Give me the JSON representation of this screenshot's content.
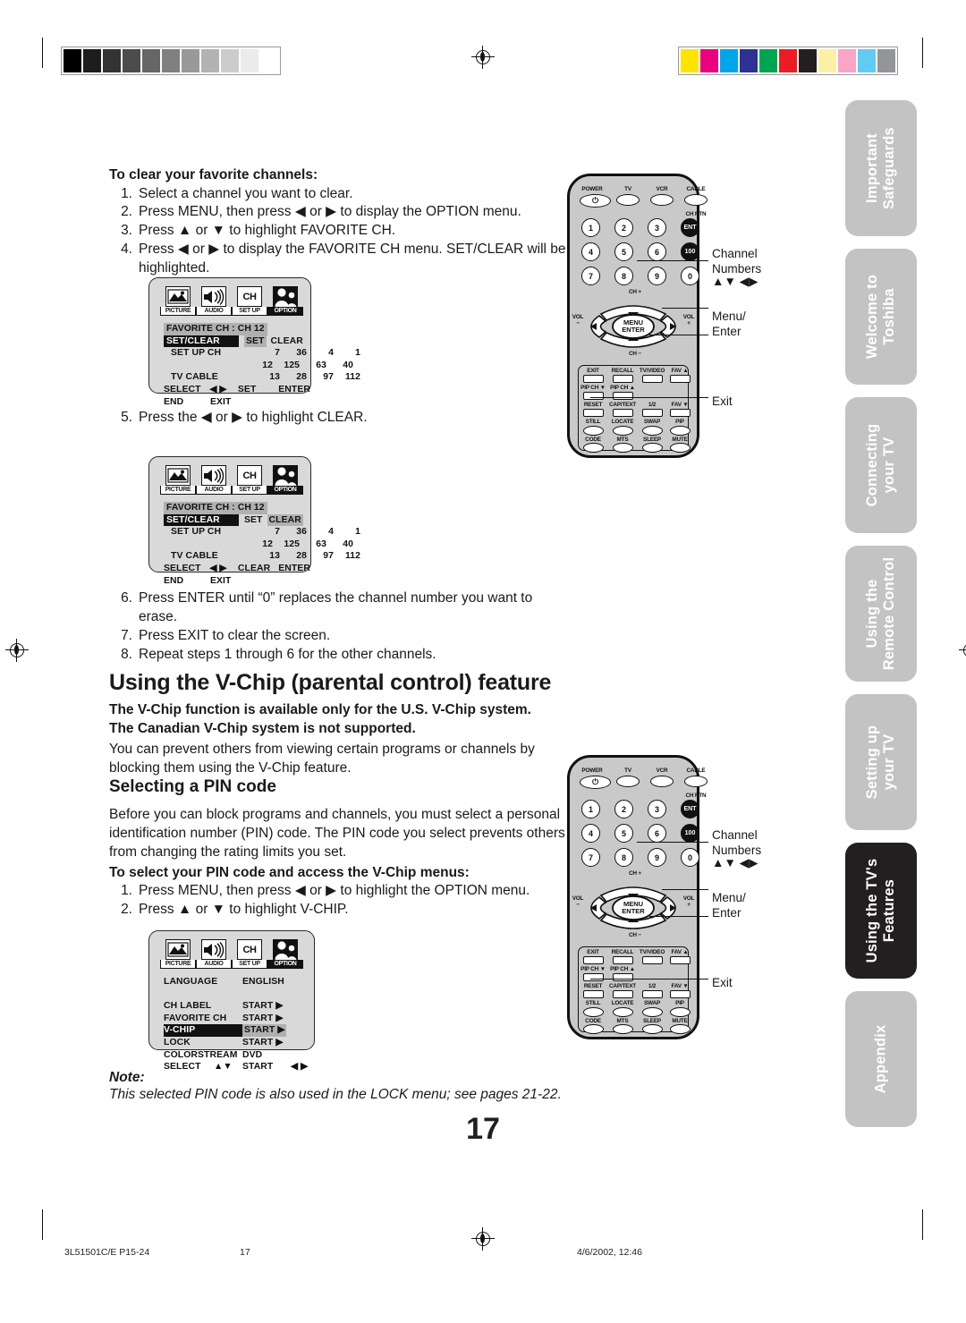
{
  "document": {
    "page_number": "17",
    "footer_left": "3L51501C/E P15-24",
    "footer_center": "17",
    "footer_right": "4/6/2002, 12:46"
  },
  "calibration": {
    "grayscale": [
      "#000000",
      "#1d1d1d",
      "#333333",
      "#4c4c4c",
      "#666666",
      "#808080",
      "#999999",
      "#b3b3b3",
      "#cccccc",
      "#ebebeb",
      "#ffffff"
    ],
    "colors": [
      "#ffe400",
      "#ea0080",
      "#00a6e9",
      "#2e3192",
      "#00a551",
      "#ed1c24",
      "#231f20",
      "#fbf0a5",
      "#f8a5c6",
      "#61cbf3",
      "#939598"
    ]
  },
  "sidebar": {
    "tabs": [
      {
        "label": "Important\nSafeguards",
        "active": false
      },
      {
        "label": "Welcome to\nToshiba",
        "active": false
      },
      {
        "label": "Connecting\nyour TV",
        "active": false
      },
      {
        "label": "Using the\nRemote Control",
        "active": false
      },
      {
        "label": "Setting up\nyour TV",
        "active": false
      },
      {
        "label": "Using the TV's\nFeatures",
        "active": true
      },
      {
        "label": "Appendix",
        "active": false
      }
    ]
  },
  "clear_favorites": {
    "heading": "To clear your favorite channels:",
    "steps": [
      {
        "num": "1.",
        "text": "Select a channel you want to clear."
      },
      {
        "num": "2.",
        "text": "Press MENU, then press ◀ or ▶ to display the OPTION menu."
      },
      {
        "num": "3.",
        "text": "Press ▲ or ▼ to highlight FAVORITE CH."
      },
      {
        "num": "4.",
        "text": "Press ◀ or ▶ to display the FAVORITE CH menu. SET/CLEAR will be highlighted."
      }
    ],
    "step5": {
      "num": "5.",
      "text": "Press the ◀ or ▶ to highlight CLEAR."
    },
    "steps_after": [
      {
        "num": "6.",
        "text": "Press ENTER until “0” replaces the channel number you want to erase."
      },
      {
        "num": "7.",
        "text": "Press EXIT to clear the screen."
      },
      {
        "num": "8.",
        "text": "Repeat steps 1 through 6 for the other channels."
      }
    ]
  },
  "vchip": {
    "section_title": "Using the V-Chip (parental control) feature",
    "bold_notice_line1": "The V-Chip function is available only for the U.S. V-Chip system.",
    "bold_notice_line2": "The Canadian V-Chip system is not supported.",
    "intro": "You can prevent others from viewing certain programs or channels by blocking them using the V-Chip feature.",
    "subsection_title": "Selecting a PIN code",
    "pin_intro": "Before you can block programs and channels, you must select a personal identification number (PIN) code. The PIN code you select prevents others from changing the rating limits you set.",
    "pin_heading": "To select your PIN code and access the V-Chip menus:",
    "pin_steps": [
      {
        "num": "1.",
        "text": "Press MENU, then press ◀ or ▶ to highlight the OPTION menu."
      },
      {
        "num": "2.",
        "text": "Press ▲ or ▼ to highlight V-CHIP."
      }
    ]
  },
  "note": {
    "title": "Note:",
    "body": "This selected PIN code is also used in the LOCK menu; see pages 21-22."
  },
  "osd_menus": {
    "icon_tabs": [
      {
        "label": "PICTURE",
        "icon": "picture-icon",
        "selected": false
      },
      {
        "label": "AUDIO",
        "icon": "audio-speaker-icon",
        "selected": false
      },
      {
        "label": "SET UP",
        "icon": "channel-ch-icon",
        "selected": false
      },
      {
        "label": "OPTION",
        "icon": "people-option-icon",
        "selected": true
      }
    ],
    "favorite_set": {
      "title": "FAVORITE CH : CH 12",
      "row_highlight_label": "SET/CLEAR",
      "mode_a": "SET",
      "mode_b": "CLEAR",
      "active_mode": "SET",
      "setup_label": "SET UP CH",
      "cable_label": "TV CABLE",
      "grid": [
        [
          "7",
          "36",
          "4",
          "1"
        ],
        [
          "12",
          "125",
          "63",
          "40"
        ],
        [
          "13",
          "28",
          "97",
          "112"
        ]
      ],
      "footer_select": "SELECT",
      "footer_arrows": "◀ ▶",
      "footer_action": "SET",
      "footer_enter": "ENTER",
      "footer_end": "END",
      "footer_exit": "EXIT"
    },
    "favorite_clear": {
      "title": "FAVORITE CH : CH 12",
      "row_highlight_label": "SET/CLEAR",
      "mode_a": "SET",
      "mode_b": "CLEAR",
      "active_mode": "CLEAR",
      "setup_label": "SET UP CH",
      "cable_label": "TV CABLE",
      "grid": [
        [
          "7",
          "36",
          "4",
          "1"
        ],
        [
          "12",
          "125",
          "63",
          "40"
        ],
        [
          "13",
          "28",
          "97",
          "112"
        ]
      ],
      "footer_select": "SELECT",
      "footer_arrows": "◀ ▶",
      "footer_action": "CLEAR",
      "footer_enter": "ENTER",
      "footer_end": "END",
      "footer_exit": "EXIT"
    },
    "option_menu": {
      "language_label": "LANGUAGE",
      "language_value": "ENGLISH",
      "items": [
        {
          "label": "CH LABEL",
          "value": "START ▶",
          "highlight": false
        },
        {
          "label": "FAVORITE CH",
          "value": "START ▶",
          "highlight": false
        },
        {
          "label": "V-CHIP",
          "value": "START ▶",
          "highlight": true
        },
        {
          "label": "LOCK",
          "value": "START ▶",
          "highlight": false
        },
        {
          "label": "COLORSTREAM",
          "value": "DVD",
          "highlight": false
        }
      ],
      "footer_select": "SELECT",
      "footer_updown": "▲▼",
      "footer_start": "START",
      "footer_arrows": "◀ ▶"
    }
  },
  "remote": {
    "top_row": [
      "POWER",
      "TV",
      "VCR",
      "CABLE"
    ],
    "ch_rtn_label": "CH RTN",
    "enter_key": "ENT",
    "hundred_key": "100",
    "numbers": [
      "1",
      "2",
      "3",
      "4",
      "5",
      "6",
      "7",
      "8",
      "9",
      "0"
    ],
    "ch_up": "CH +",
    "ch_down": "CH −",
    "vol_down_label": "VOL",
    "vol_down_sign": "−",
    "vol_up_label": "VOL",
    "vol_up_sign": "+",
    "center_line1": "MENU",
    "center_line2": "ENTER",
    "row_exit": [
      "EXIT",
      "RECALL",
      "TV/VIDEO",
      "FAV ▲"
    ],
    "row_pip": [
      "PIP CH ▼",
      "PIP CH ▲"
    ],
    "row_reset": [
      "RESET",
      "CAP/TEXT",
      "1/2",
      "FAV ▼"
    ],
    "row_still": [
      "STILL",
      "LOCATE",
      "SWAP",
      "PIP"
    ],
    "row_code": [
      "CODE",
      "MTS",
      "SLEEP",
      "MUTE"
    ],
    "callouts": {
      "channel_numbers": "Channel\nNumbers",
      "arrows": "▲▼ ◀▶",
      "menu_enter": "Menu/\nEnter",
      "exit": "Exit"
    }
  }
}
